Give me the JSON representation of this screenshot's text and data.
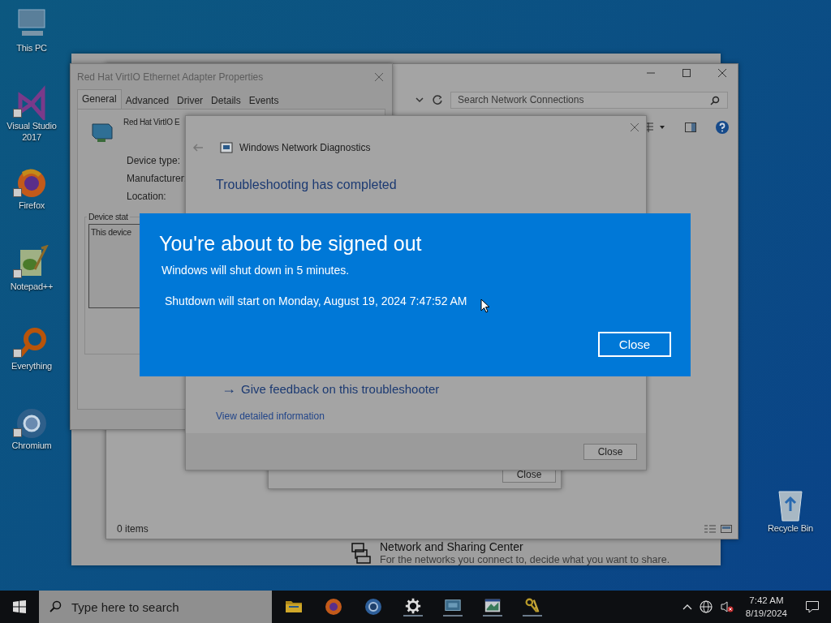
{
  "desktop_icons": [
    {
      "label": "This PC"
    },
    {
      "label": "Visual Studio 2017"
    },
    {
      "label": "Firefox"
    },
    {
      "label": "Notepad++"
    },
    {
      "label": "Everything"
    },
    {
      "label": "Chromium"
    }
  ],
  "recycle_bin": {
    "label": "Recycle Bin"
  },
  "sharing_center": {
    "title": "Network and Sharing Center",
    "description": "For the networks you connect to, decide what you want to share."
  },
  "explorer": {
    "search": {
      "placeholder": "Search Network Connections"
    },
    "status_bar": "0 items"
  },
  "properties": {
    "title": "Red Hat VirtIO Ethernet Adapter Properties",
    "tabs": [
      {
        "label": "General",
        "selected": true
      },
      {
        "label": "Advanced",
        "selected": false
      },
      {
        "label": "Driver",
        "selected": false
      },
      {
        "label": "Details",
        "selected": false
      },
      {
        "label": "Events",
        "selected": false
      }
    ],
    "device_name": "Red Hat VirtIO E",
    "fields": [
      "Device type:",
      "Manufacturer:",
      "Location:"
    ],
    "status_group": "Device stat",
    "status_text": "This device"
  },
  "troubleshooter": {
    "button": "Close"
  },
  "diagnostics": {
    "title": "Windows Network Diagnostics",
    "heading": "Troubleshooting has completed",
    "feedback_arrow": "→",
    "feedback": "Give feedback on this troubleshooter",
    "details_link": "View detailed information",
    "button": "Close"
  },
  "dialog": {
    "title": "You're about to be signed out",
    "message": "Windows will shut down in 5 minutes.",
    "detail": "Shutdown will start on Monday, August 19, 2024 7:47:52 AM",
    "button": "Close"
  },
  "taskbar": {
    "search": {
      "placeholder": "Type here to search"
    },
    "time": "7:42 AM",
    "date": "8/19/2024"
  }
}
